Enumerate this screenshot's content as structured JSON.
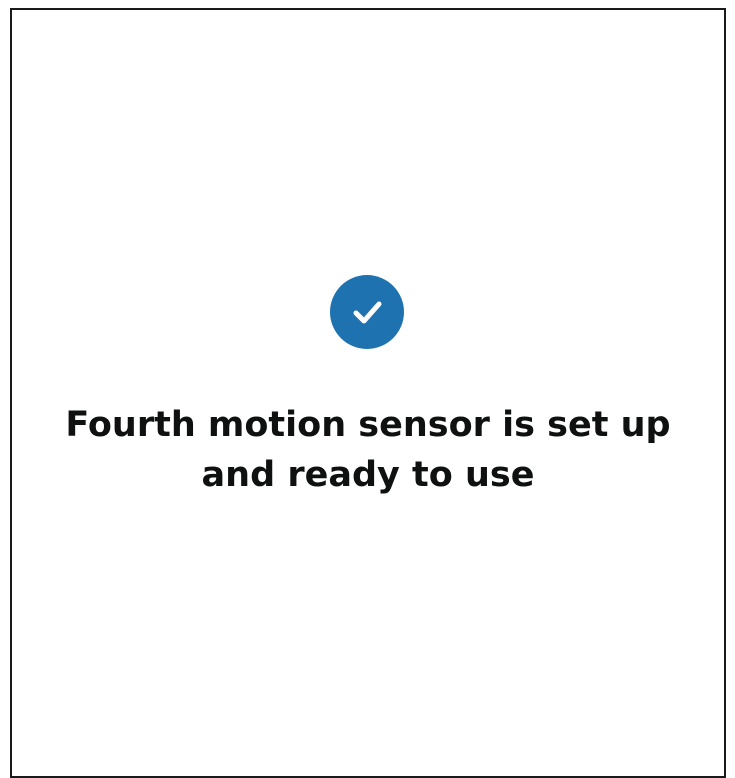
{
  "confirmation": {
    "icon": "checkmark-circle-icon",
    "message": "Fourth motion sensor is set up and ready to use"
  },
  "colors": {
    "accent": "#1f72b0",
    "text": "#0f1111",
    "background": "#ffffff",
    "border": "#1a1a1a"
  }
}
